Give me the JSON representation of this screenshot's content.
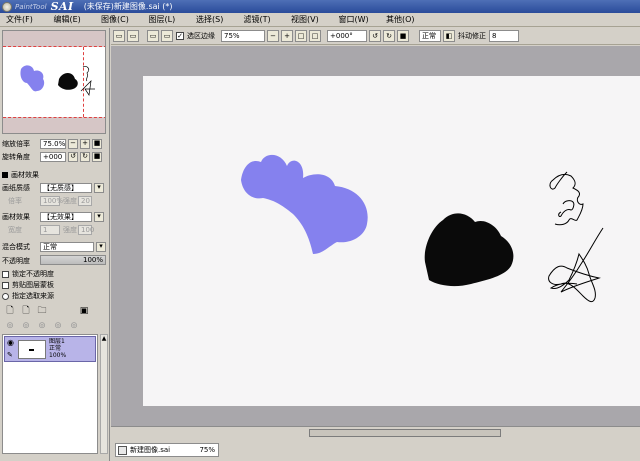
{
  "app": {
    "logo_text": "PaintTool",
    "logo_name": "SAI",
    "window_title": "(未保存)新建图像.sai (*)"
  },
  "menu": [
    "文件(F)",
    "编辑(E)",
    "图像(C)",
    "图层(L)",
    "选择(S)",
    "滤镜(T)",
    "视图(V)",
    "窗口(W)",
    "其他(O)"
  ],
  "navigator": {
    "zoom_label": "缩放倍率",
    "zoom_value": "75.0%",
    "rotate_label": "旋转角度",
    "rotate_value": "+000"
  },
  "texture": {
    "section": "画材效果",
    "paper_label": "画纸质感",
    "paper_value": "【无质感】",
    "paper_sub_label": "倍率",
    "paper_sub_value": "100%",
    "paper_sub_right": "强度",
    "paper_sub_num": "20",
    "effect_label": "画材效果",
    "effect_value": "【无效果】",
    "effect_sub_label": "宽度",
    "effect_sub_value": "1",
    "effect_sub_right": "强度",
    "effect_sub_num": "100"
  },
  "layer_props": {
    "blend_label": "混合模式",
    "blend_value": "正常",
    "opacity_label": "不透明度",
    "opacity_value": "100%",
    "checks": [
      "锁定不透明度",
      "剪贴图层蒙板"
    ],
    "radio": "指定选取来源"
  },
  "layer": {
    "name": "图层1",
    "mode": "正常",
    "opacity": "100%"
  },
  "toolbar": {
    "selection_label": "选区边缘",
    "zoom": "75%",
    "rotation": "+000°",
    "mode": "正常",
    "stabilizer_label": "抖动修正",
    "stabilizer_value": "8"
  },
  "statusbar": {
    "doc_name": "新建图像.sai",
    "doc_zoom": "75%"
  },
  "colors": {
    "blob_blue": "#8581ee",
    "blob_black": "#0a0a0a"
  }
}
